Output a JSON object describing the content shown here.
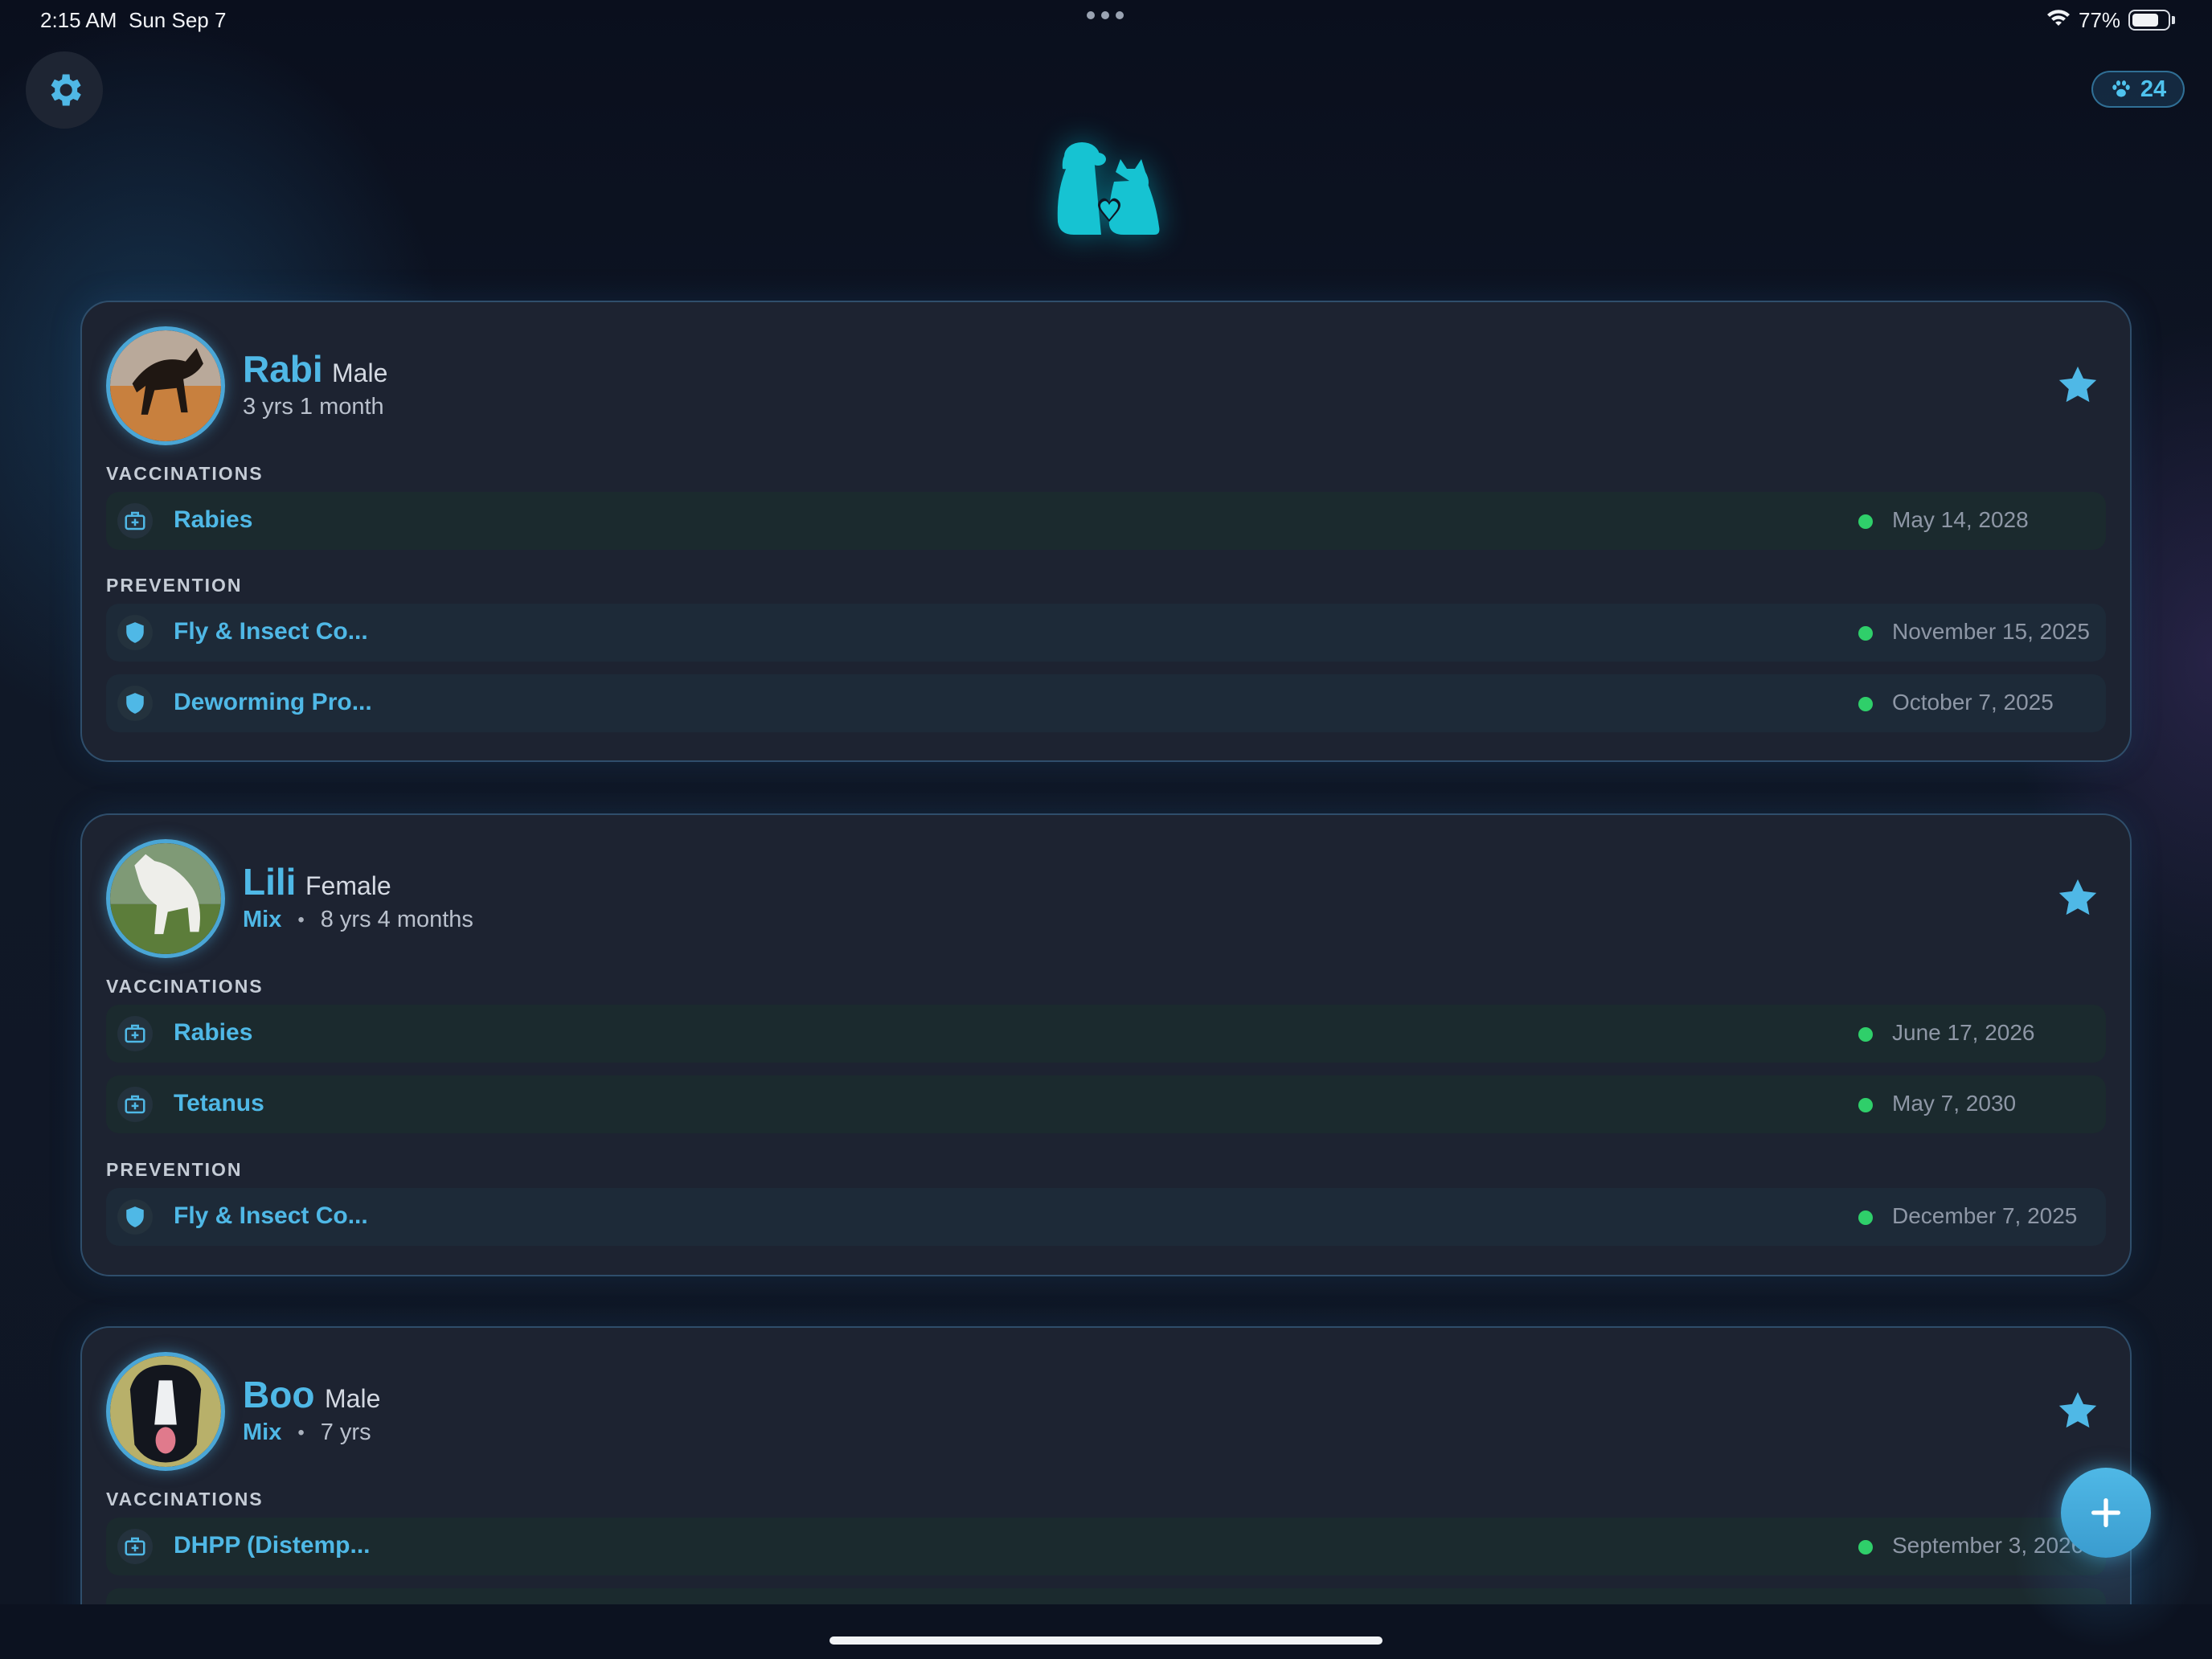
{
  "status_bar": {
    "time": "2:15 AM",
    "date": "Sun Sep 7",
    "battery": "77%",
    "icons": [
      "wifi-icon",
      "battery-icon"
    ]
  },
  "header": {
    "settings_icon": "gear-icon",
    "pet_count": "24",
    "pet_count_icon": "paw-icon",
    "logo_icon": "dog-cat-heart-logo"
  },
  "colors": {
    "accent": "#4fb8e6",
    "ok": "#2fcf6a",
    "card": "#1d2331",
    "background": "#0c1220"
  },
  "sections": {
    "vaccinations": "VACCINATIONS",
    "prevention": "PREVENTION"
  },
  "pets": [
    {
      "name": "Rabi",
      "gender": "Male",
      "breed": "",
      "age": "3 yrs 1 month",
      "favorite": true,
      "vaccinations": [
        {
          "name": "Rabies",
          "date": "May 14, 2028",
          "icon": "medical-kit-icon"
        }
      ],
      "prevention": [
        {
          "name": "Fly & Insect Co...",
          "date": "November 15, 2025",
          "icon": "shield-icon"
        },
        {
          "name": "Deworming Pro...",
          "date": "October 7, 2025",
          "icon": "shield-icon"
        }
      ]
    },
    {
      "name": "Lili",
      "gender": "Female",
      "breed": "Mix",
      "separator": "•",
      "age": "8 yrs 4 months",
      "favorite": true,
      "vaccinations": [
        {
          "name": "Rabies",
          "date": "June 17, 2026",
          "icon": "medical-kit-icon"
        },
        {
          "name": "Tetanus",
          "date": "May 7, 2030",
          "icon": "medical-kit-icon"
        }
      ],
      "prevention": [
        {
          "name": "Fly & Insect Co...",
          "date": "December 7, 2025",
          "icon": "shield-icon"
        }
      ]
    },
    {
      "name": "Boo",
      "gender": "Male",
      "breed": "Mix",
      "separator": "•",
      "age": "7 yrs",
      "favorite": true,
      "vaccinations": [
        {
          "name": "DHPP (Distemp...",
          "date": "September 3, 2026",
          "icon": "medical-kit-icon"
        }
      ]
    }
  ],
  "fab": {
    "icon": "plus-icon"
  }
}
